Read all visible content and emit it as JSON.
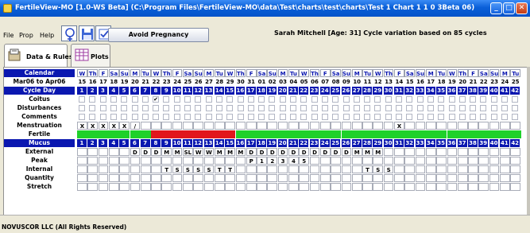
{
  "window": {
    "title": "FertileView-MO [1.0-WS Beta] (C:\\Program Files\\FertileView-MO\\data\\Test\\charts\\test\\charts\\Test 1 Chart 1 1 0 3Beta 06)"
  },
  "menu": [
    "File",
    "Prop",
    "Help"
  ],
  "toolbar": {
    "avoid_pregnancy_label": "Avoid Pregnancy",
    "user_info": "Sarah Mitchell  [Age: 31]   Cycle variation based on 85 cycles"
  },
  "tabs": [
    {
      "label": "Data & Rules",
      "active": true
    },
    {
      "label": "Plots",
      "active": false
    }
  ],
  "chart": {
    "calendar_label": "Calendar",
    "date_range_label": "Mar06 to Apr06",
    "cycle_day_label": "Cycle Day",
    "mucus_label": "Mucus",
    "weekdays": [
      "W",
      "Th",
      "F",
      "Sa",
      "Su",
      "M",
      "Tu",
      "W",
      "Th",
      "F",
      "Sa",
      "Su",
      "M",
      "Tu",
      "W",
      "Th",
      "F",
      "Sa",
      "Su",
      "M",
      "Tu",
      "W",
      "Th",
      "F",
      "Sa",
      "Su",
      "M",
      "Tu",
      "W",
      "Th",
      "F",
      "Sa",
      "Su",
      "M",
      "Tu",
      "W",
      "Th",
      "F",
      "Sa",
      "Su",
      "M",
      "Tu"
    ],
    "dates": [
      "15",
      "16",
      "17",
      "18",
      "19",
      "20",
      "21",
      "22",
      "23",
      "24",
      "25",
      "26",
      "27",
      "28",
      "29",
      "30",
      "31",
      "01",
      "02",
      "03",
      "04",
      "05",
      "06",
      "07",
      "08",
      "09",
      "10",
      "11",
      "12",
      "13",
      "14",
      "15",
      "16",
      "17",
      "18",
      "19",
      "20",
      "21",
      "22",
      "23",
      "24",
      "25"
    ],
    "cycle_days": [
      "1",
      "2",
      "3",
      "4",
      "5",
      "6",
      "7",
      "8",
      "9",
      "10",
      "11",
      "12",
      "13",
      "14",
      "15",
      "16",
      "17",
      "18",
      "19",
      "20",
      "21",
      "22",
      "23",
      "24",
      "25",
      "26",
      "27",
      "28",
      "29",
      "30",
      "31",
      "32",
      "33",
      "34",
      "35",
      "36",
      "37",
      "38",
      "39",
      "40",
      "41",
      "42"
    ],
    "checkbox_rows": [
      {
        "label": "Coitus",
        "checked": [
          7
        ]
      },
      {
        "label": "Disturbances",
        "checked": []
      },
      {
        "label": "Comments",
        "checked": []
      }
    ],
    "menstruation": {
      "label": "Menstruation",
      "marks": [
        "X",
        "X",
        "X",
        "X",
        "X",
        "/",
        "",
        "",
        "",
        "",
        "",
        "",
        "",
        "",
        "",
        "",
        "",
        "",
        "",
        "",
        "",
        "",
        "",
        "",
        "",
        "",
        "",
        "",
        "",
        "",
        "X",
        "",
        "",
        "",
        "",
        "",
        "",
        "",
        "",
        "",
        "",
        ""
      ]
    },
    "fertile": {
      "label": "Fertile",
      "colors": {
        "green": "#1fd12a",
        "red": "#e1161c"
      },
      "pattern": [
        "g",
        "g",
        "g",
        "g",
        "g",
        "g",
        "g",
        "r",
        "r",
        "r",
        "r",
        "r",
        "r",
        "r",
        "r",
        "g",
        "g",
        "g",
        "g",
        "g",
        "g",
        "g",
        "g",
        "g",
        "g",
        "g",
        "g",
        "g",
        "g",
        "g",
        "g",
        "g",
        "g",
        "g",
        "g",
        "g",
        "g",
        "g",
        "g",
        "g",
        "g",
        "g"
      ]
    },
    "detail_rows": [
      {
        "label": "External",
        "values": [
          "",
          "",
          "",
          "",
          "",
          "D",
          "D",
          "D",
          "M",
          "M",
          "SL",
          "W",
          "W",
          "M",
          "M",
          "M",
          "D",
          "D",
          "D",
          "D",
          "D",
          "D",
          "D",
          "D",
          "D",
          "D",
          "M",
          "M",
          "M",
          "",
          "",
          "",
          "",
          "",
          "",
          "",
          "",
          "",
          "",
          "",
          "",
          ""
        ]
      },
      {
        "label": "Peak",
        "values": [
          "",
          "",
          "",
          "",
          "",
          "",
          "",
          "",
          "",
          "",
          "",
          "",
          "",
          "",
          "",
          "",
          "P",
          "1",
          "2",
          "3",
          "4",
          "5",
          "",
          "",
          "",
          "",
          "",
          "",
          "",
          "",
          "",
          "",
          "",
          "",
          "",
          "",
          "",
          "",
          "",
          "",
          "",
          ""
        ]
      },
      {
        "label": "Internal",
        "values": [
          "",
          "",
          "",
          "",
          "",
          "",
          "",
          "",
          "T",
          "S",
          "S",
          "S",
          "S",
          "T",
          "T",
          "",
          "",
          "",
          "",
          "",
          "",
          "",
          "",
          "",
          "",
          "",
          "",
          "T",
          "S",
          "S",
          "",
          "",
          "",
          "",
          "",
          "",
          "",
          "",
          "",
          "",
          "",
          ""
        ]
      },
      {
        "label": "Quantity",
        "values": []
      },
      {
        "label": "Stretch",
        "values": []
      }
    ]
  },
  "footer": {
    "copyright": "NOVUSCOR LLC (All Rights Reserved)"
  },
  "colors": {
    "header_blue": "#0a17b0",
    "title_blue": "#0453c9"
  }
}
